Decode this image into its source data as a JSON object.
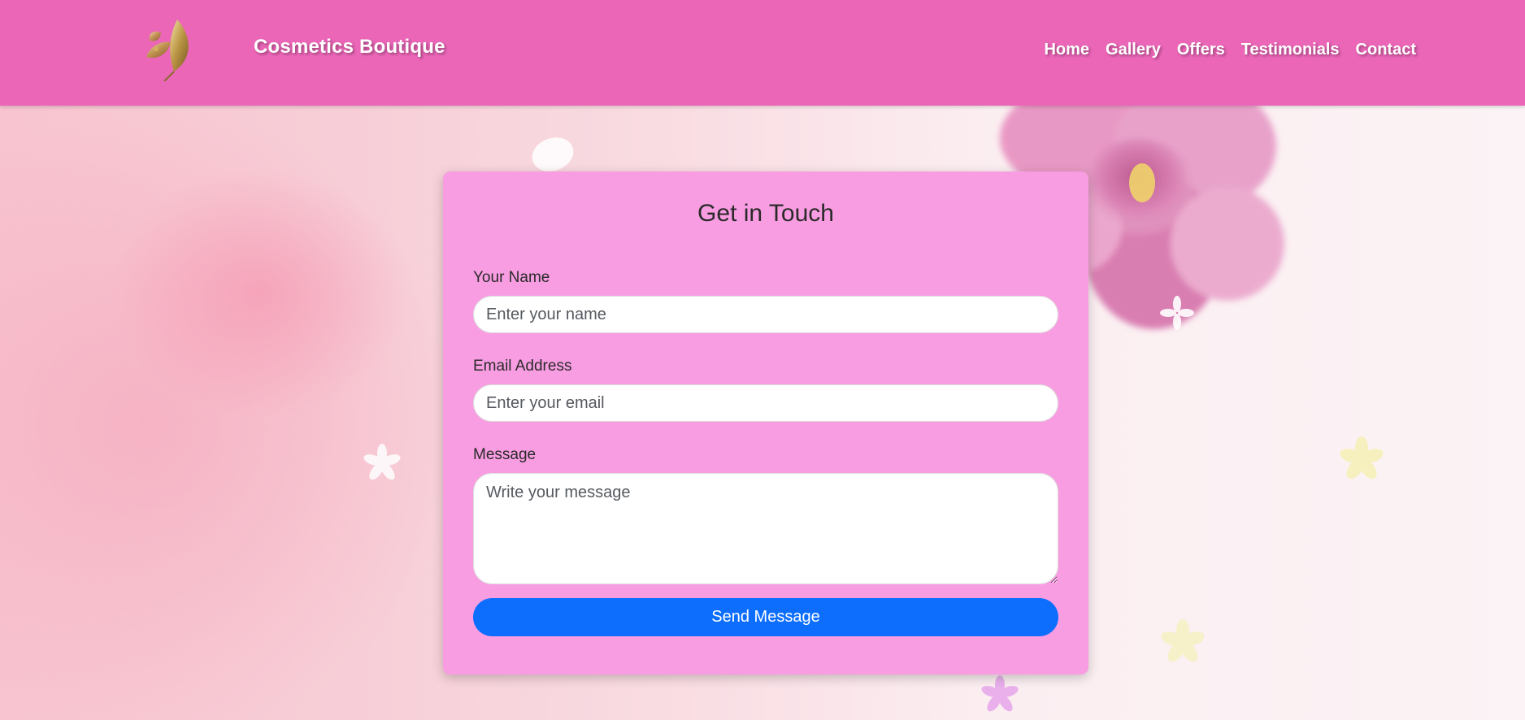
{
  "header": {
    "brand": "Cosmetics Boutique",
    "logo_icon": "leaf-logo-icon",
    "background_color": "#ec66b8",
    "nav": [
      "Home",
      "Gallery",
      "Offers",
      "Testimonials",
      "Contact"
    ]
  },
  "contact_form": {
    "title": "Get in Touch",
    "name_label": "Your Name",
    "name_placeholder": "Enter your name",
    "email_label": "Email Address",
    "email_placeholder": "Enter your email",
    "message_label": "Message",
    "message_placeholder": "Write your message",
    "submit_label": "Send Message",
    "card_color": "#f99de2",
    "button_color": "#0d6efd"
  }
}
